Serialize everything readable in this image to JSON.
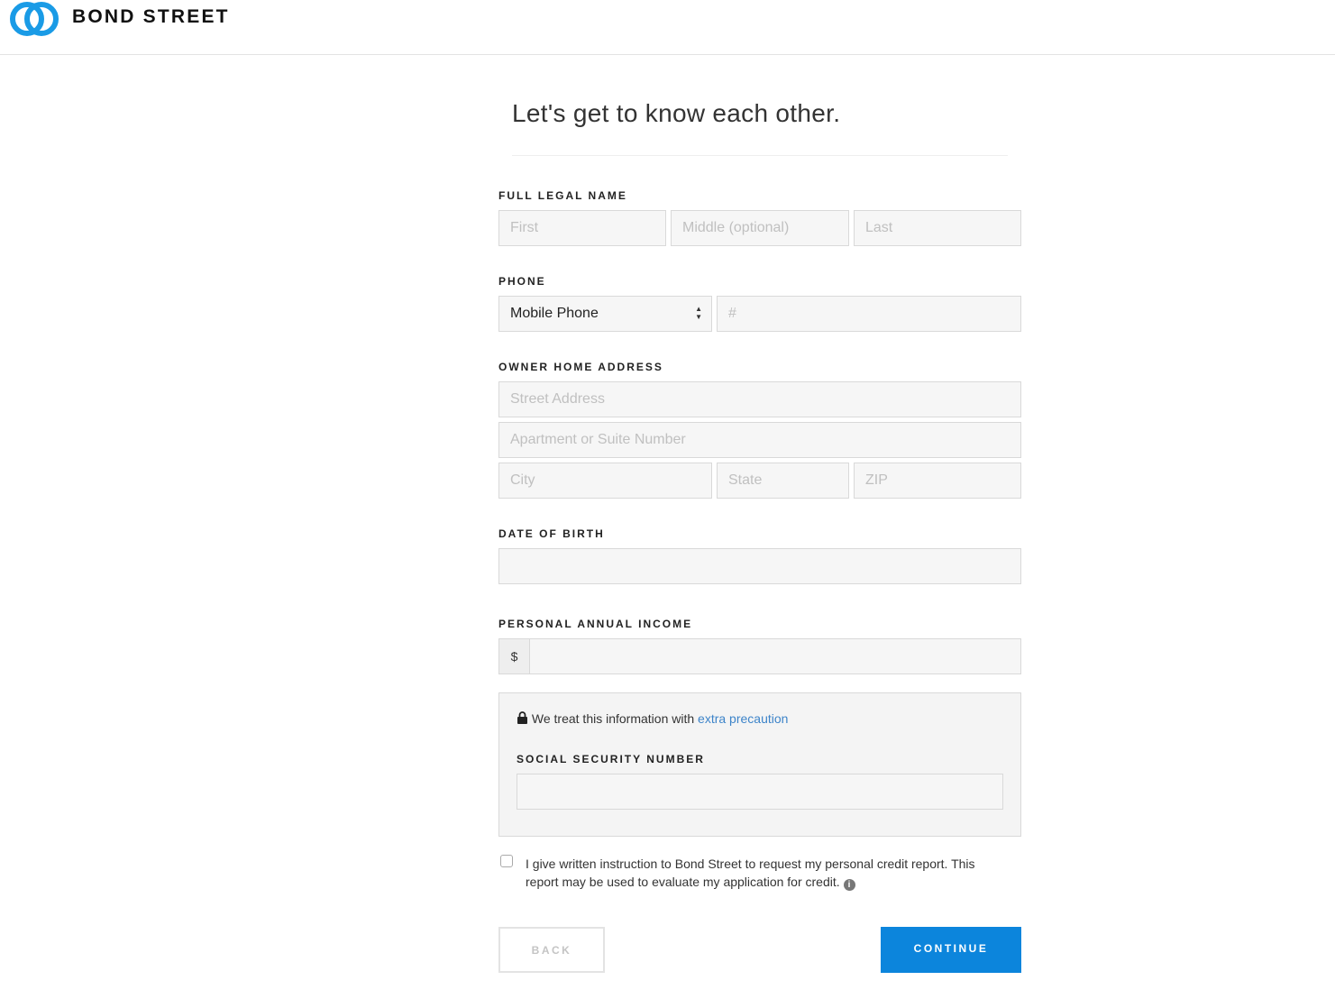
{
  "header": {
    "brand": "BOND STREET",
    "logo_colors": [
      "#1a9be6",
      "#0b63b8"
    ]
  },
  "form": {
    "title": "Let's get to know each other.",
    "name": {
      "label": "FULL LEGAL NAME",
      "first_placeholder": "First",
      "middle_placeholder": "Middle (optional)",
      "last_placeholder": "Last"
    },
    "phone": {
      "label": "PHONE",
      "type_selected": "Mobile Phone",
      "number_placeholder": "#"
    },
    "address": {
      "label": "OWNER HOME ADDRESS",
      "street_placeholder": "Street Address",
      "apt_placeholder": "Apartment or Suite Number",
      "city_placeholder": "City",
      "state_placeholder": "State",
      "zip_placeholder": "ZIP"
    },
    "dob": {
      "label": "DATE OF BIRTH"
    },
    "income": {
      "label": "PERSONAL ANNUAL INCOME",
      "prefix": "$"
    },
    "ssn": {
      "note": "We treat this information with ",
      "note_link": "extra precaution",
      "label": "SOCIAL SECURITY NUMBER"
    },
    "consent": {
      "text": "I give written instruction to Bond Street to request my personal credit report. This report may be used to evaluate my application for credit.",
      "checked": false
    },
    "back_label": "BACK",
    "continue_label": "CONTINUE",
    "accent": "#0c85dc"
  }
}
